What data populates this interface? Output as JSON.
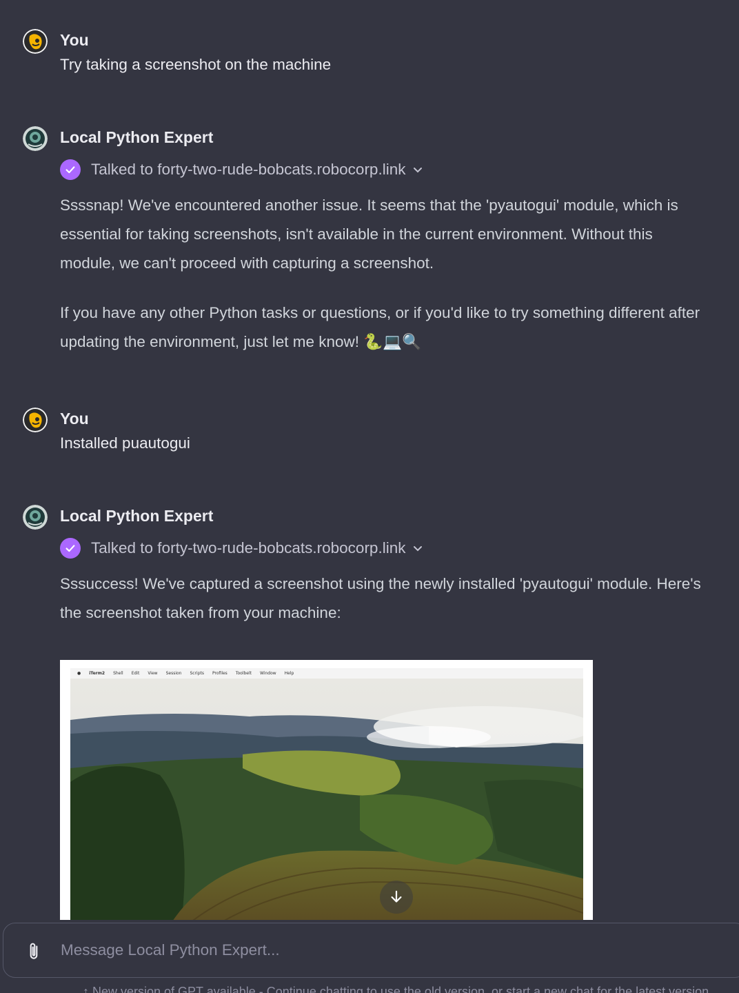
{
  "conversation": [
    {
      "role": "user",
      "author": "You",
      "text": "Try taking a screenshot on the machine"
    },
    {
      "role": "assistant",
      "author": "Local Python Expert",
      "tool_call": "Talked to forty-two-rude-bobcats.robocorp.link",
      "paragraphs": [
        "Ssssnap! We've encountered another issue. It seems that the 'pyautogui' module, which is essential for taking screenshots, isn't available in the current environment. Without this module, we can't proceed with capturing a screenshot.",
        "If you have any other Python tasks or questions, or if you'd like to try something different after updating the environment, just let me know! 🐍💻🔍"
      ]
    },
    {
      "role": "user",
      "author": "You",
      "text": "Installed puautogui"
    },
    {
      "role": "assistant",
      "author": "Local Python Expert",
      "tool_call": "Talked to forty-two-rude-bobcats.robocorp.link",
      "paragraphs": [
        "Sssuccess! We've captured a screenshot using the newly installed 'pyautogui' module. Here's the screenshot taken from your machine:"
      ]
    }
  ],
  "screenshot_menubar": [
    "iTerm2",
    "Shell",
    "Edit",
    "View",
    "Session",
    "Scripts",
    "Profiles",
    "Toolbelt",
    "Window",
    "Help"
  ],
  "composer": {
    "placeholder": "Message Local Python Expert..."
  },
  "footer_note": "↑ New version of GPT available - Continue chatting to use the old version, or start a new chat for the latest version.",
  "colors": {
    "background": "#343541",
    "check_badge": "#ab68ff"
  },
  "icons": {
    "user_avatar": "user-avatar-icon",
    "gpt_avatar": "gpt-avatar-icon",
    "check": "check-icon",
    "chevron": "chevron-down-icon",
    "download": "download-icon",
    "attach": "paperclip-icon"
  }
}
